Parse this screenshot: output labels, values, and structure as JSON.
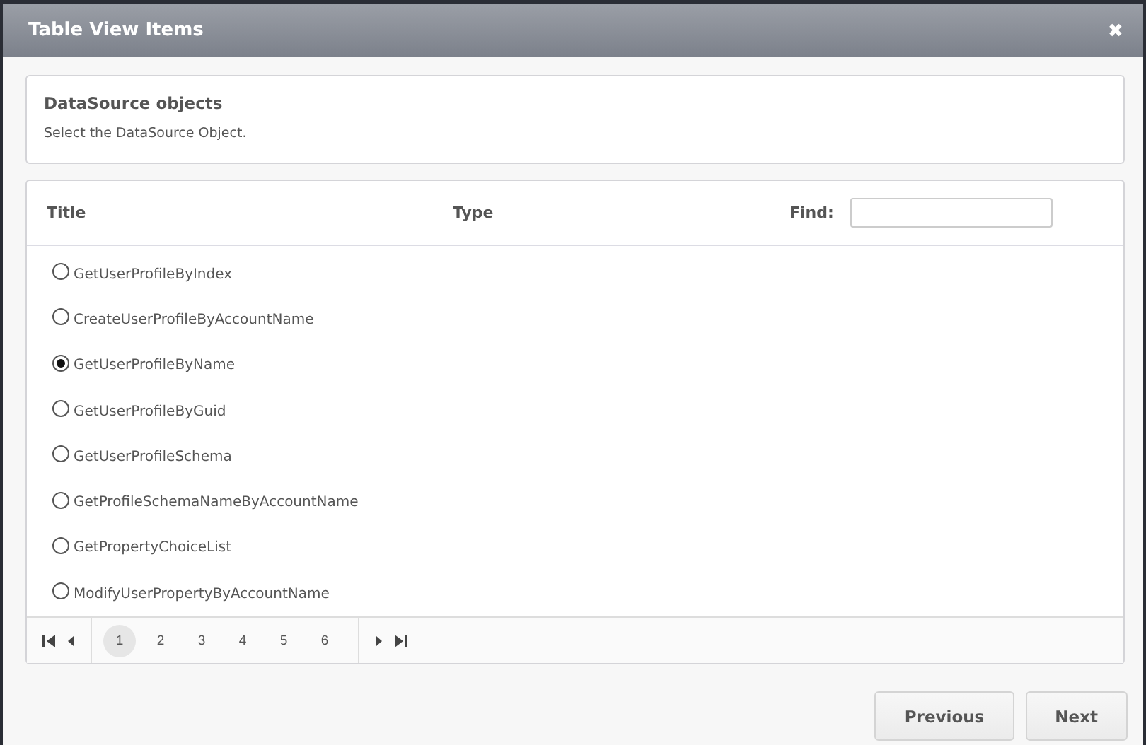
{
  "dialog": {
    "title": "Table View Items",
    "close": "✖"
  },
  "info": {
    "title": "DataSource objects",
    "text": "Select the DataSource Object."
  },
  "table": {
    "columns": [
      "Title",
      "Type"
    ],
    "find": {
      "label": "Find:"
    },
    "rows": [
      {
        "title": "GetUserProfileByIndex",
        "selected": false
      },
      {
        "title": "CreateUserProfileByAccountName",
        "selected": false
      },
      {
        "title": "GetUserProfileByName",
        "selected": true
      },
      {
        "title": "GetUserProfileByGuid",
        "selected": false
      },
      {
        "title": "GetUserProfileSchema",
        "selected": false
      },
      {
        "title": "GetProfileSchemaNameByAccountName",
        "selected": false
      },
      {
        "title": "GetPropertyChoiceList",
        "selected": false
      },
      {
        "title": "ModifyUserPropertyByAccountName",
        "selected": false
      }
    ],
    "pages": [
      {
        "label": "1",
        "selected": true
      },
      {
        "label": "2",
        "selected": false
      },
      {
        "label": "3",
        "selected": false
      },
      {
        "label": "4",
        "selected": false
      },
      {
        "label": "5",
        "selected": false
      },
      {
        "label": "6",
        "selected": false
      }
    ]
  },
  "buttons": [
    "Previous",
    "Next"
  ]
}
